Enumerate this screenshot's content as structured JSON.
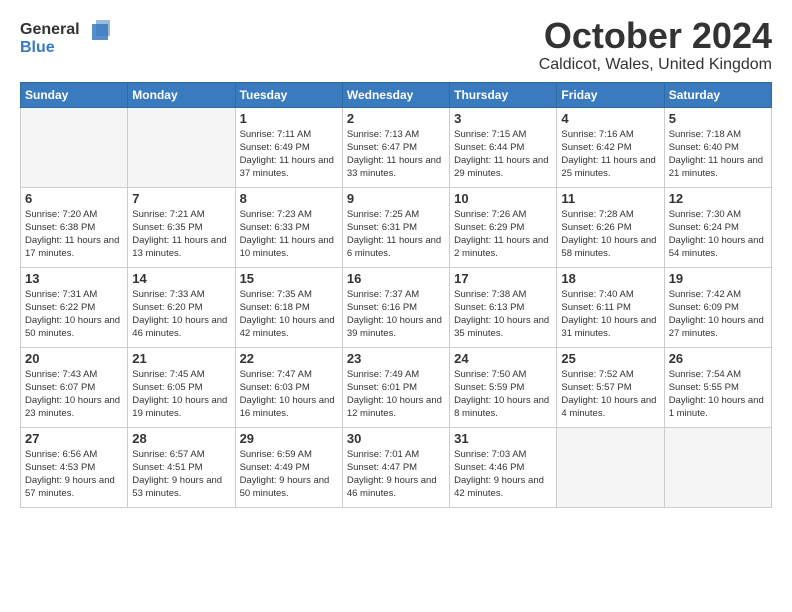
{
  "header": {
    "logo_general": "General",
    "logo_blue": "Blue",
    "month": "October 2024",
    "location": "Caldicot, Wales, United Kingdom"
  },
  "days_of_week": [
    "Sunday",
    "Monday",
    "Tuesday",
    "Wednesday",
    "Thursday",
    "Friday",
    "Saturday"
  ],
  "weeks": [
    [
      {
        "day": "",
        "text": ""
      },
      {
        "day": "",
        "text": ""
      },
      {
        "day": "1",
        "text": "Sunrise: 7:11 AM\nSunset: 6:49 PM\nDaylight: 11 hours and 37 minutes."
      },
      {
        "day": "2",
        "text": "Sunrise: 7:13 AM\nSunset: 6:47 PM\nDaylight: 11 hours and 33 minutes."
      },
      {
        "day": "3",
        "text": "Sunrise: 7:15 AM\nSunset: 6:44 PM\nDaylight: 11 hours and 29 minutes."
      },
      {
        "day": "4",
        "text": "Sunrise: 7:16 AM\nSunset: 6:42 PM\nDaylight: 11 hours and 25 minutes."
      },
      {
        "day": "5",
        "text": "Sunrise: 7:18 AM\nSunset: 6:40 PM\nDaylight: 11 hours and 21 minutes."
      }
    ],
    [
      {
        "day": "6",
        "text": "Sunrise: 7:20 AM\nSunset: 6:38 PM\nDaylight: 11 hours and 17 minutes."
      },
      {
        "day": "7",
        "text": "Sunrise: 7:21 AM\nSunset: 6:35 PM\nDaylight: 11 hours and 13 minutes."
      },
      {
        "day": "8",
        "text": "Sunrise: 7:23 AM\nSunset: 6:33 PM\nDaylight: 11 hours and 10 minutes."
      },
      {
        "day": "9",
        "text": "Sunrise: 7:25 AM\nSunset: 6:31 PM\nDaylight: 11 hours and 6 minutes."
      },
      {
        "day": "10",
        "text": "Sunrise: 7:26 AM\nSunset: 6:29 PM\nDaylight: 11 hours and 2 minutes."
      },
      {
        "day": "11",
        "text": "Sunrise: 7:28 AM\nSunset: 6:26 PM\nDaylight: 10 hours and 58 minutes."
      },
      {
        "day": "12",
        "text": "Sunrise: 7:30 AM\nSunset: 6:24 PM\nDaylight: 10 hours and 54 minutes."
      }
    ],
    [
      {
        "day": "13",
        "text": "Sunrise: 7:31 AM\nSunset: 6:22 PM\nDaylight: 10 hours and 50 minutes."
      },
      {
        "day": "14",
        "text": "Sunrise: 7:33 AM\nSunset: 6:20 PM\nDaylight: 10 hours and 46 minutes."
      },
      {
        "day": "15",
        "text": "Sunrise: 7:35 AM\nSunset: 6:18 PM\nDaylight: 10 hours and 42 minutes."
      },
      {
        "day": "16",
        "text": "Sunrise: 7:37 AM\nSunset: 6:16 PM\nDaylight: 10 hours and 39 minutes."
      },
      {
        "day": "17",
        "text": "Sunrise: 7:38 AM\nSunset: 6:13 PM\nDaylight: 10 hours and 35 minutes."
      },
      {
        "day": "18",
        "text": "Sunrise: 7:40 AM\nSunset: 6:11 PM\nDaylight: 10 hours and 31 minutes."
      },
      {
        "day": "19",
        "text": "Sunrise: 7:42 AM\nSunset: 6:09 PM\nDaylight: 10 hours and 27 minutes."
      }
    ],
    [
      {
        "day": "20",
        "text": "Sunrise: 7:43 AM\nSunset: 6:07 PM\nDaylight: 10 hours and 23 minutes."
      },
      {
        "day": "21",
        "text": "Sunrise: 7:45 AM\nSunset: 6:05 PM\nDaylight: 10 hours and 19 minutes."
      },
      {
        "day": "22",
        "text": "Sunrise: 7:47 AM\nSunset: 6:03 PM\nDaylight: 10 hours and 16 minutes."
      },
      {
        "day": "23",
        "text": "Sunrise: 7:49 AM\nSunset: 6:01 PM\nDaylight: 10 hours and 12 minutes."
      },
      {
        "day": "24",
        "text": "Sunrise: 7:50 AM\nSunset: 5:59 PM\nDaylight: 10 hours and 8 minutes."
      },
      {
        "day": "25",
        "text": "Sunrise: 7:52 AM\nSunset: 5:57 PM\nDaylight: 10 hours and 4 minutes."
      },
      {
        "day": "26",
        "text": "Sunrise: 7:54 AM\nSunset: 5:55 PM\nDaylight: 10 hours and 1 minute."
      }
    ],
    [
      {
        "day": "27",
        "text": "Sunrise: 6:56 AM\nSunset: 4:53 PM\nDaylight: 9 hours and 57 minutes."
      },
      {
        "day": "28",
        "text": "Sunrise: 6:57 AM\nSunset: 4:51 PM\nDaylight: 9 hours and 53 minutes."
      },
      {
        "day": "29",
        "text": "Sunrise: 6:59 AM\nSunset: 4:49 PM\nDaylight: 9 hours and 50 minutes."
      },
      {
        "day": "30",
        "text": "Sunrise: 7:01 AM\nSunset: 4:47 PM\nDaylight: 9 hours and 46 minutes."
      },
      {
        "day": "31",
        "text": "Sunrise: 7:03 AM\nSunset: 4:46 PM\nDaylight: 9 hours and 42 minutes."
      },
      {
        "day": "",
        "text": ""
      },
      {
        "day": "",
        "text": ""
      }
    ]
  ]
}
